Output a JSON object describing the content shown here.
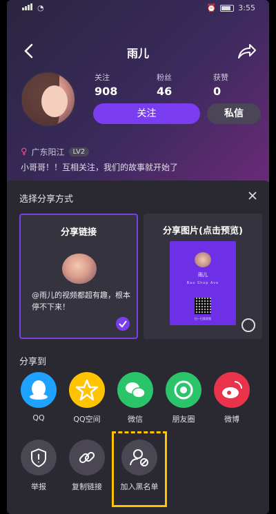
{
  "status": {
    "time": "3:55",
    "battery": "88"
  },
  "nav": {
    "title": "雨儿"
  },
  "profile": {
    "stats": [
      {
        "label": "关注",
        "value": "908"
      },
      {
        "label": "粉丝",
        "value": "46"
      },
      {
        "label": "获赞",
        "value": "0"
      }
    ],
    "follow_label": "关注",
    "message_label": "私信",
    "gender_symbol": "♀",
    "location": "广东阳江",
    "level": "LV2",
    "bio": "小哥哥！！互相关注，我们的故事就开始了"
  },
  "sheet": {
    "title": "选择分享方式",
    "cards": [
      {
        "title": "分享链接",
        "text": "@雨儿的视频都超有趣，根本停不下来！",
        "selected": true
      },
      {
        "title": "分享图片(点击预览)",
        "selected": false
      }
    ],
    "poster": {
      "name": "雨儿",
      "tag": "Bao Shop Ave",
      "footer": "扫一扫看视频"
    },
    "share_to_label": "分享到",
    "share_targets": [
      {
        "name": "QQ",
        "icon": "qq-icon",
        "color": "#1fa2ff"
      },
      {
        "name": "QQ空间",
        "icon": "qzone-star-icon",
        "color": "#ffc300"
      },
      {
        "name": "微信",
        "icon": "wechat-icon",
        "color": "#2bc46a"
      },
      {
        "name": "朋友圈",
        "icon": "moments-icon",
        "color": "#2bc46a"
      },
      {
        "name": "微博",
        "icon": "weibo-icon",
        "color": "#e8334a"
      }
    ],
    "actions": [
      {
        "name": "举报",
        "icon": "report-shield-icon"
      },
      {
        "name": "复制链接",
        "icon": "link-icon"
      },
      {
        "name": "加入黑名单",
        "icon": "blacklist-user-icon"
      }
    ]
  }
}
